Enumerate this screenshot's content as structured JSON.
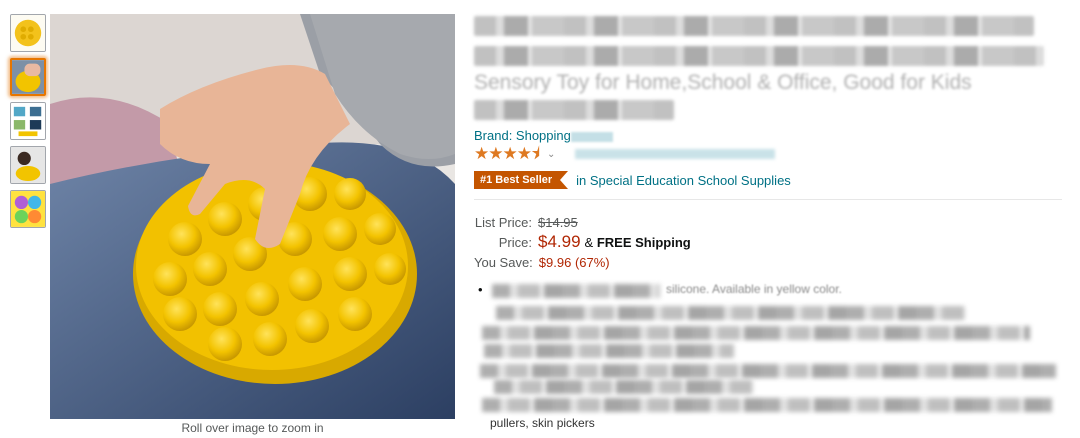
{
  "zoom_hint": "Roll over image to zoom in",
  "thumbnails": [
    {
      "name": "thumb-1",
      "active": false
    },
    {
      "name": "thumb-2",
      "active": true
    },
    {
      "name": "thumb-3",
      "active": false
    },
    {
      "name": "thumb-4",
      "active": false
    },
    {
      "name": "thumb-5",
      "active": false
    }
  ],
  "title_visible": "Sensory Toy for Home,School & Office, Good for Kids",
  "brand_label": "Brand: Shopping",
  "rating_stars": "★★★★⯨",
  "bestseller_badge": "#1 Best Seller",
  "bestseller_category": "in Special Education School Supplies",
  "price": {
    "list_label": "List Price:",
    "list_value": "$14.95",
    "price_label": "Price:",
    "price_value": "$4.99",
    "shipping_prefix": "&",
    "shipping": "FREE Shipping",
    "save_label": "You Save:",
    "save_value": "$9.96 (67%)"
  },
  "bullet_visible_fragment": "silicone. Available in yellow color.",
  "bullets_tail": "pullers, skin pickers",
  "colors": {
    "accent_orange": "#e77600",
    "price_red": "#b12704",
    "link_teal": "#007185",
    "badge": "#c45500",
    "star": "#de7921"
  }
}
